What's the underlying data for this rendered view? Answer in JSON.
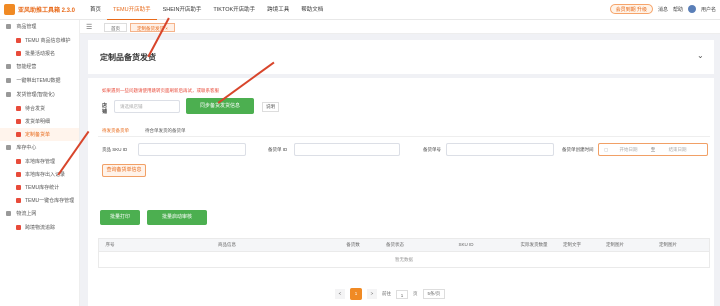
{
  "app": {
    "title": "亚风助推工具箱 2.3.0"
  },
  "nav": [
    "首页",
    "TEMU开店助手",
    "SHEIN开店助手",
    "TIKTOK开店助手",
    "跨境工具",
    "帮助文档"
  ],
  "topright": {
    "vip": "会员到期 升级",
    "notice": "消息",
    "help": "帮助",
    "user": "用户名"
  },
  "sidebar": {
    "items": [
      {
        "label": "商品管理",
        "level": 0
      },
      {
        "label": "TEMU 商品信息维护",
        "level": 1
      },
      {
        "label": "批量活动报名",
        "level": 1
      },
      {
        "label": "智能经营",
        "level": 0
      },
      {
        "label": "一键带出TEMU数据",
        "level": 0
      },
      {
        "label": "发货管理(智能化)",
        "level": 0
      },
      {
        "label": "待合发货",
        "level": 1
      },
      {
        "label": "发货单明细",
        "level": 1
      },
      {
        "label": "定制备货单",
        "level": 1,
        "active": true
      },
      {
        "label": "库存中心",
        "level": 0
      },
      {
        "label": "本地库存管理",
        "level": 1
      },
      {
        "label": "本地库存出入记录",
        "level": 1
      },
      {
        "label": "TEMU库存统计",
        "level": 1
      },
      {
        "label": "TEMU一键仓库存管理",
        "level": 1
      },
      {
        "label": "物流上网",
        "level": 0
      },
      {
        "label": "跨境物流追踪",
        "level": 1
      }
    ]
  },
  "tabs": [
    "首页",
    "定制备货发货"
  ],
  "page": {
    "title": "定制品备货发货",
    "hint": "如果遇到一些问题请使用跳转页面刷新后再试，或联系客服",
    "store_label": "店铺",
    "store_placeholder": "请选择店铺",
    "sync_button": "同步备货发货信息",
    "help_link": "说明",
    "subtabs": [
      "待发货备货单",
      "待合单发货的备货单"
    ],
    "filters": {
      "sku_label": "货品 SKU ID",
      "spu_label": "备货单 ID",
      "order_label": "备货单号",
      "time_label": "备货单创建时间",
      "start_placeholder": "开始日期",
      "end_placeholder": "结束日期",
      "range_sep": "至"
    },
    "search_button": "查询备货单信息",
    "print_button": "批量打印",
    "batch_button": "批量启动审核",
    "table_headers": [
      "序号",
      "商品信息",
      "备货数",
      "备货状态",
      "SKU ID",
      "实际发货数量",
      "定制文字",
      "定制图片",
      "定制图片"
    ],
    "empty": "暂无数据",
    "pagination": {
      "prev": "<",
      "current": "1",
      "next": ">",
      "goto": "前往",
      "page_suffix": "页",
      "page_size": "5条/页"
    }
  }
}
